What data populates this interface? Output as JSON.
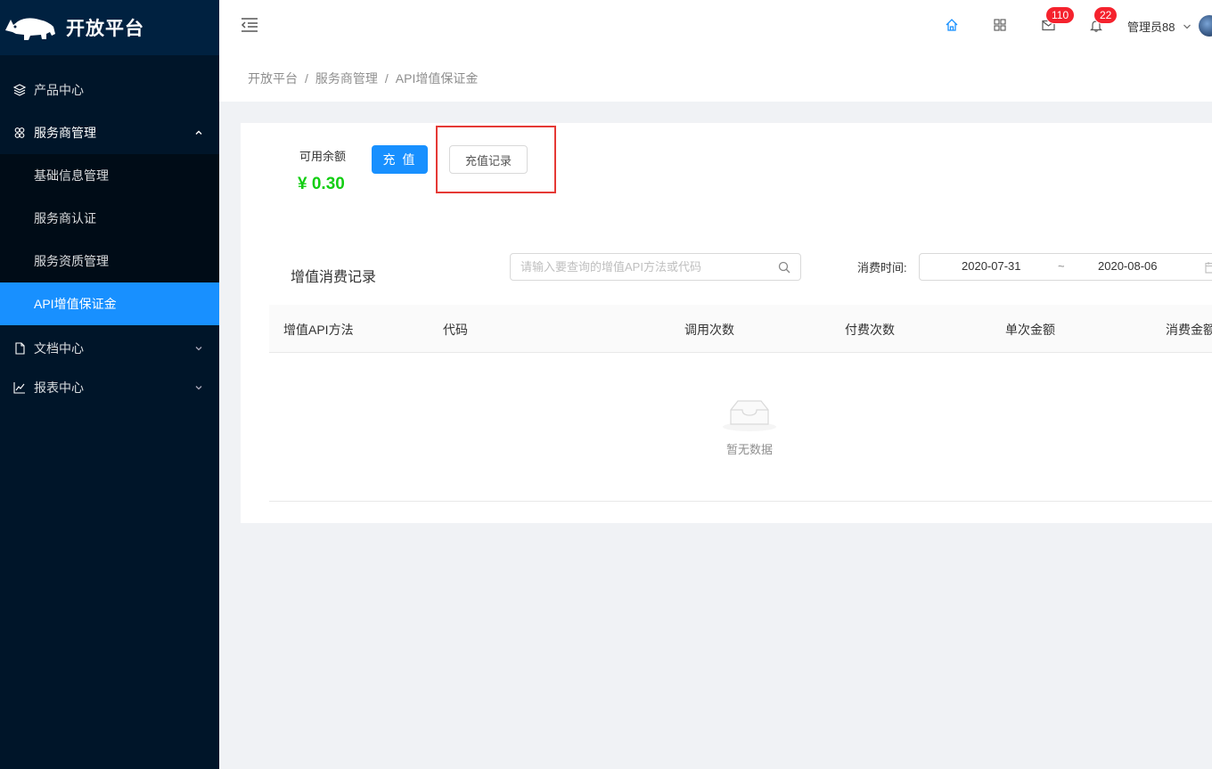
{
  "sidebar": {
    "logo_text": "开放平台",
    "items": [
      {
        "label": "产品中心",
        "icon": "layers-icon"
      },
      {
        "label": "服务商管理",
        "icon": "team-icon",
        "open": true,
        "children": [
          {
            "label": "基础信息管理"
          },
          {
            "label": "服务商认证"
          },
          {
            "label": "服务资质管理"
          },
          {
            "label": "API增值保证金",
            "active": true
          }
        ]
      },
      {
        "label": "文档中心",
        "icon": "file-icon"
      },
      {
        "label": "报表中心",
        "icon": "line-chart-icon"
      }
    ]
  },
  "header": {
    "mail_badge": "110",
    "bell_badge": "22",
    "user_name": "管理员88"
  },
  "breadcrumb": [
    "开放平台",
    "服务商管理",
    "API增值保证金"
  ],
  "balance": {
    "label": "可用余额",
    "amount": "¥ 0.30",
    "recharge_label": "充 值",
    "records_label": "充值记录"
  },
  "consumption": {
    "title": "增值消费记录",
    "search_placeholder": "请输入要查询的增值API方法或代码",
    "date_label": "消费时间:",
    "date_start": "2020-07-31",
    "date_sep": "~",
    "date_end": "2020-08-06",
    "columns": [
      "增值API方法",
      "代码",
      "调用次数",
      "付费次数",
      "单次金额",
      "消费金额"
    ],
    "empty_text": "暂无数据"
  },
  "colors": {
    "sidebar_bg": "#001529",
    "primary": "#1890ff",
    "amount_green": "#13ce13",
    "badge_red": "#f5222d",
    "highlight_red": "#e53935"
  }
}
